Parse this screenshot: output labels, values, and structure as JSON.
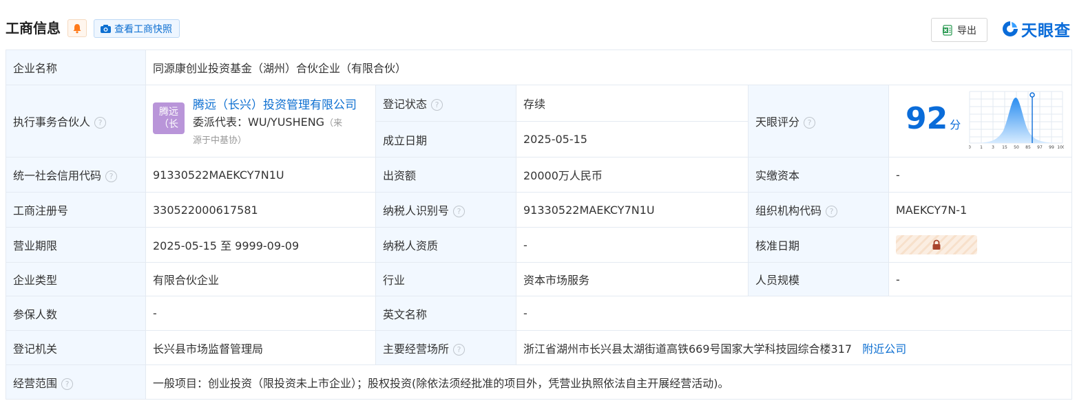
{
  "header": {
    "title": "工商信息",
    "snapshot_label": "查看工商快照",
    "export_label": "导出",
    "brand_name": "天眼查"
  },
  "colors": {
    "accent": "#0a6cd9",
    "label_bg": "#f2f8ff",
    "status_green": "#2fa84f",
    "avatar_purple": "#b995d9"
  },
  "fields": {
    "company_name_label": "企业名称",
    "company_name": "同源康创业投资基金（湖州）合伙企业（有限合伙）",
    "partner_label": "执行事务合伙人",
    "partner_avatar": "腾远（长",
    "partner_name": "腾远（长兴）投资管理有限公司",
    "partner_rep": "委派代表：WU/YUSHENG",
    "partner_src_a": "（来",
    "partner_src_b": "源于中基协）",
    "status_label": "登记状态",
    "status": "存续",
    "founded_label": "成立日期",
    "founded": "2025-05-15",
    "score_label": "天眼评分",
    "score": "92",
    "score_unit": "分",
    "score_axis": [
      "0",
      "1",
      "3",
      "15",
      "50",
      "85",
      "97",
      "99",
      "100"
    ],
    "credit_code_label": "统一社会信用代码",
    "credit_code": "91330522MAEKCY7N1U",
    "capital_label": "出资额",
    "capital": "20000万人民币",
    "paid_capital_label": "实缴资本",
    "paid_capital": "-",
    "reg_no_label": "工商注册号",
    "reg_no": "330522000617581",
    "taxpayer_id_label": "纳税人识别号",
    "taxpayer_id": "91330522MAEKCY7N1U",
    "org_code_label": "组织机构代码",
    "org_code": "MAEKCY7N-1",
    "term_label": "营业期限",
    "term": "2025-05-15 至 9999-09-09",
    "taxpayer_qual_label": "纳税人资质",
    "taxpayer_qual": "-",
    "approval_date_label": "核准日期",
    "type_label": "企业类型",
    "type": "有限合伙企业",
    "industry_label": "行业",
    "industry": "资本市场服务",
    "staff_label": "人员规模",
    "staff": "-",
    "insured_label": "参保人数",
    "insured": "-",
    "english_name_label": "英文名称",
    "english_name": "-",
    "authority_label": "登记机关",
    "authority": "长兴县市场监督管理局",
    "address_label": "主要经营场所",
    "address": "浙江省湖州市长兴县太湖街道高铁669号国家大学科技园综合楼317",
    "nearby_link": "附近公司",
    "scope_label": "经营范围",
    "scope": "一般项目：创业投资（限投资未上市企业）；股权投资(除依法须经批准的项目外，凭营业执照依法自主开展经营活动)。"
  }
}
